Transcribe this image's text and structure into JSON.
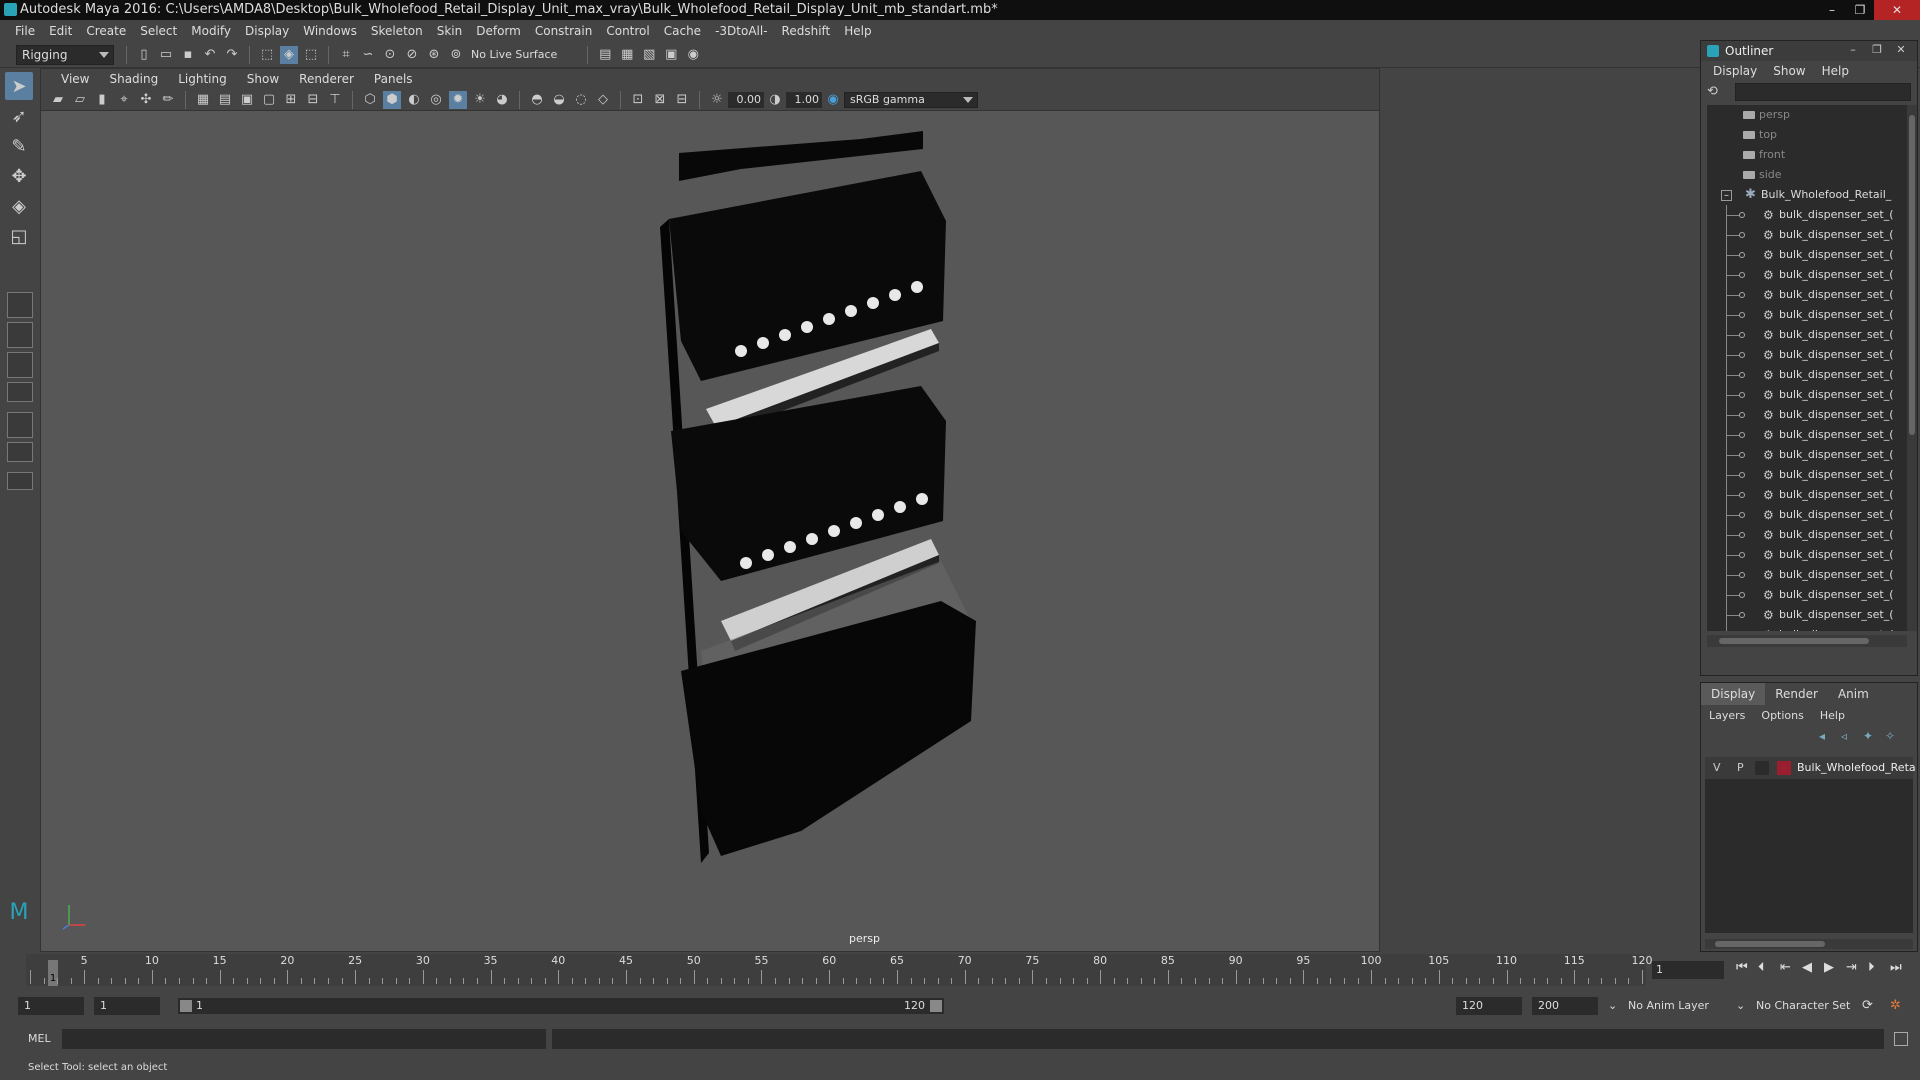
{
  "window": {
    "title": "Autodesk Maya 2016: C:\\Users\\AMDA8\\Desktop\\Bulk_Wholefood_Retail_Display_Unit_max_vray\\Bulk_Wholefood_Retail_Display_Unit_mb_standart.mb*",
    "controls": [
      "–",
      "❐",
      "✕"
    ]
  },
  "menubar": [
    "File",
    "Edit",
    "Create",
    "Select",
    "Modify",
    "Display",
    "Windows",
    "Skeleton",
    "Skin",
    "Deform",
    "Constrain",
    "Control",
    "Cache",
    "-3DtoAll-",
    "Redshift",
    "Help"
  ],
  "shelf": {
    "mode": "Rigging",
    "live_surface": "No Live Surface"
  },
  "panel": {
    "menu": [
      "View",
      "Shading",
      "Lighting",
      "Show",
      "Renderer",
      "Panels"
    ],
    "exposure": "0.00",
    "gamma": "1.00",
    "color_space": "sRGB gamma",
    "camera_label": "persp"
  },
  "outliner": {
    "title": "Outliner",
    "menu": [
      "Display",
      "Show",
      "Help"
    ],
    "cameras": [
      "persp",
      "top",
      "front",
      "side"
    ],
    "group": "Bulk_Wholefood_Retail_",
    "children": [
      "bulk_dispenser_set_(",
      "bulk_dispenser_set_(",
      "bulk_dispenser_set_(",
      "bulk_dispenser_set_(",
      "bulk_dispenser_set_(",
      "bulk_dispenser_set_(",
      "bulk_dispenser_set_(",
      "bulk_dispenser_set_(",
      "bulk_dispenser_set_(",
      "bulk_dispenser_set_(",
      "bulk_dispenser_set_(",
      "bulk_dispenser_set_(",
      "bulk_dispenser_set_(",
      "bulk_dispenser_set_(",
      "bulk_dispenser_set_(",
      "bulk_dispenser_set_(",
      "bulk_dispenser_set_(",
      "bulk_dispenser_set_(",
      "bulk_dispenser_set_(",
      "bulk_dispenser_set_(",
      "bulk_dispenser_set_(",
      "bulk_dispenser_set_("
    ]
  },
  "layers": {
    "tabs": [
      "Display",
      "Render",
      "Anim"
    ],
    "menu": [
      "Layers",
      "Options",
      "Help"
    ],
    "rows": [
      {
        "v": "V",
        "p": "P",
        "name": "Bulk_Wholefood_Reta",
        "color": "#9a1f2e"
      }
    ]
  },
  "timeline": {
    "ticks": [
      5,
      10,
      15,
      20,
      25,
      30,
      35,
      40,
      45,
      50,
      55,
      60,
      65,
      70,
      75,
      80,
      85,
      90,
      95,
      100,
      105,
      110,
      115,
      120
    ],
    "start": 1,
    "end": 120,
    "current_frame": "1",
    "frame_field": "1"
  },
  "range": {
    "start": "1",
    "start2": "1",
    "slider_start": "1",
    "slider_end": "120",
    "end": "120",
    "max_end": "200",
    "anim_layer": "No Anim Layer",
    "character_set": "No Character Set"
  },
  "cmdline": {
    "label": "MEL"
  },
  "helpline": {
    "text": "Select Tool: select an object"
  }
}
